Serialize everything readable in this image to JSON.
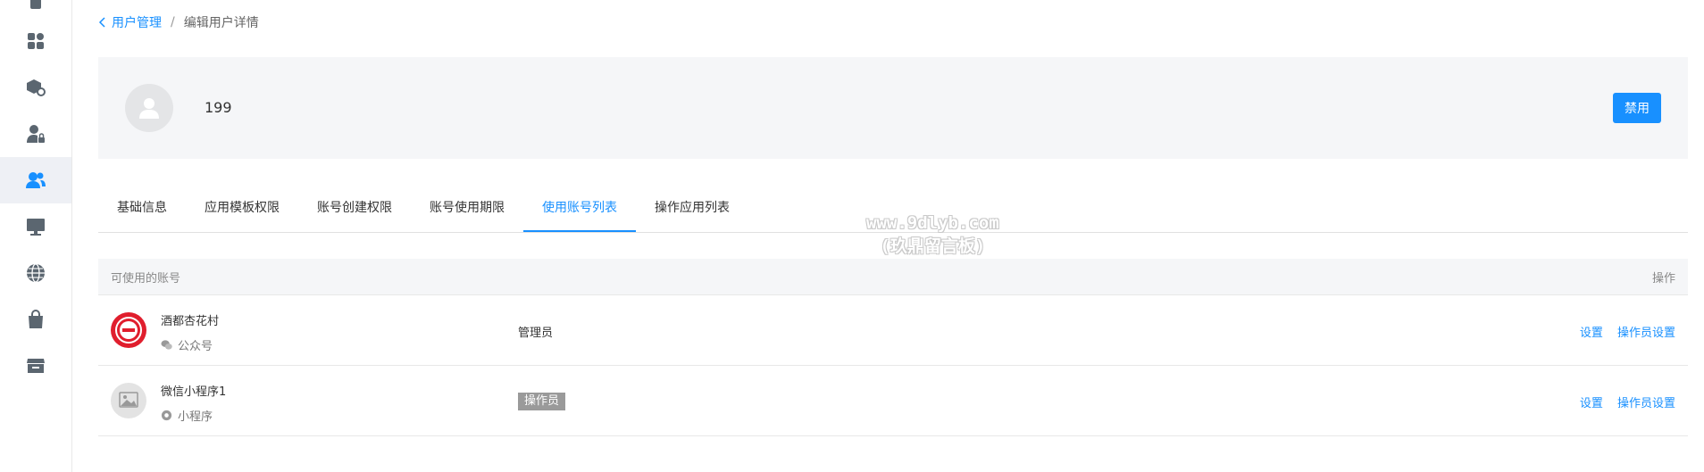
{
  "breadcrumb": {
    "back_label": "用户管理",
    "separator": "/",
    "current": "编辑用户详情"
  },
  "profile": {
    "username": "199",
    "disable_label": "禁用"
  },
  "tabs": [
    {
      "label": "基础信息",
      "active": false
    },
    {
      "label": "应用模板权限",
      "active": false
    },
    {
      "label": "账号创建权限",
      "active": false
    },
    {
      "label": "账号使用期限",
      "active": false
    },
    {
      "label": "使用账号列表",
      "active": true
    },
    {
      "label": "操作应用列表",
      "active": false
    }
  ],
  "watermark": {
    "line1": "www.9dlyb.com",
    "line2": "(玖鼎留言板)"
  },
  "table": {
    "header_account": "可使用的账号",
    "header_action": "操作",
    "rows": [
      {
        "name": "酒都杏花村",
        "type": "公众号",
        "role": "管理员",
        "action1": "设置",
        "action2": "操作员设置"
      },
      {
        "name": "微信小程序1",
        "type": "小程序",
        "role": "操作员",
        "action1": "设置",
        "action2": "操作员设置"
      }
    ]
  },
  "sidebar": {
    "icons": [
      "apps-icon",
      "package-settings-icon",
      "user-lock-icon",
      "users-icon",
      "monitor-icon",
      "globe-icon",
      "shopping-bag-icon",
      "store-icon"
    ],
    "active": "users-icon"
  },
  "colors": {
    "accent": "#1890ff",
    "icon": "#5b6670"
  }
}
